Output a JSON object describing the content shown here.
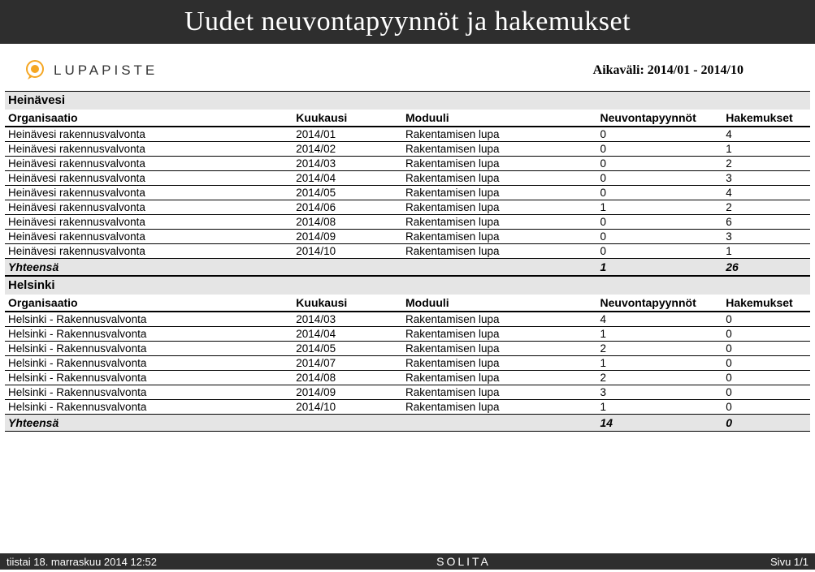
{
  "header": {
    "title": "Uudet neuvontapyynnöt ja hakemukset"
  },
  "logo": {
    "brand": "LUPAPISTE"
  },
  "date_range": {
    "label": "Aikaväli: 2014/01 - 2014/10"
  },
  "columns": {
    "org": "Organisaatio",
    "month": "Kuukausi",
    "module": "Moduuli",
    "requests": "Neuvontapyynnöt",
    "applications": "Hakemukset"
  },
  "totals_label": "Yhteensä",
  "sections": [
    {
      "name": "Heinävesi",
      "rows": [
        {
          "org": "Heinävesi rakennusvalvonta",
          "month": "2014/01",
          "module": "Rakentamisen lupa",
          "requests": "0",
          "applications": "4"
        },
        {
          "org": "Heinävesi rakennusvalvonta",
          "month": "2014/02",
          "module": "Rakentamisen lupa",
          "requests": "0",
          "applications": "1"
        },
        {
          "org": "Heinävesi rakennusvalvonta",
          "month": "2014/03",
          "module": "Rakentamisen lupa",
          "requests": "0",
          "applications": "2"
        },
        {
          "org": "Heinävesi rakennusvalvonta",
          "month": "2014/04",
          "module": "Rakentamisen lupa",
          "requests": "0",
          "applications": "3"
        },
        {
          "org": "Heinävesi rakennusvalvonta",
          "month": "2014/05",
          "module": "Rakentamisen lupa",
          "requests": "0",
          "applications": "4"
        },
        {
          "org": "Heinävesi rakennusvalvonta",
          "month": "2014/06",
          "module": "Rakentamisen lupa",
          "requests": "1",
          "applications": "2"
        },
        {
          "org": "Heinävesi rakennusvalvonta",
          "month": "2014/08",
          "module": "Rakentamisen lupa",
          "requests": "0",
          "applications": "6"
        },
        {
          "org": "Heinävesi rakennusvalvonta",
          "month": "2014/09",
          "module": "Rakentamisen lupa",
          "requests": "0",
          "applications": "3"
        },
        {
          "org": "Heinävesi rakennusvalvonta",
          "month": "2014/10",
          "module": "Rakentamisen lupa",
          "requests": "0",
          "applications": "1"
        }
      ],
      "total_requests": "1",
      "total_applications": "26"
    },
    {
      "name": "Helsinki",
      "rows": [
        {
          "org": "Helsinki - Rakennusvalvonta",
          "month": "2014/03",
          "module": "Rakentamisen lupa",
          "requests": "4",
          "applications": "0"
        },
        {
          "org": "Helsinki - Rakennusvalvonta",
          "month": "2014/04",
          "module": "Rakentamisen lupa",
          "requests": "1",
          "applications": "0"
        },
        {
          "org": "Helsinki - Rakennusvalvonta",
          "month": "2014/05",
          "module": "Rakentamisen lupa",
          "requests": "2",
          "applications": "0"
        },
        {
          "org": "Helsinki - Rakennusvalvonta",
          "month": "2014/07",
          "module": "Rakentamisen lupa",
          "requests": "1",
          "applications": "0"
        },
        {
          "org": "Helsinki - Rakennusvalvonta",
          "month": "2014/08",
          "module": "Rakentamisen lupa",
          "requests": "2",
          "applications": "0"
        },
        {
          "org": "Helsinki - Rakennusvalvonta",
          "month": "2014/09",
          "module": "Rakentamisen lupa",
          "requests": "3",
          "applications": "0"
        },
        {
          "org": "Helsinki - Rakennusvalvonta",
          "month": "2014/10",
          "module": "Rakentamisen lupa",
          "requests": "1",
          "applications": "0"
        }
      ],
      "total_requests": "14",
      "total_applications": "0"
    }
  ],
  "footer": {
    "timestamp": "tiistai 18. marraskuu 2014 12:52",
    "vendor": "SOLITA",
    "page": "Sivu 1/1"
  }
}
